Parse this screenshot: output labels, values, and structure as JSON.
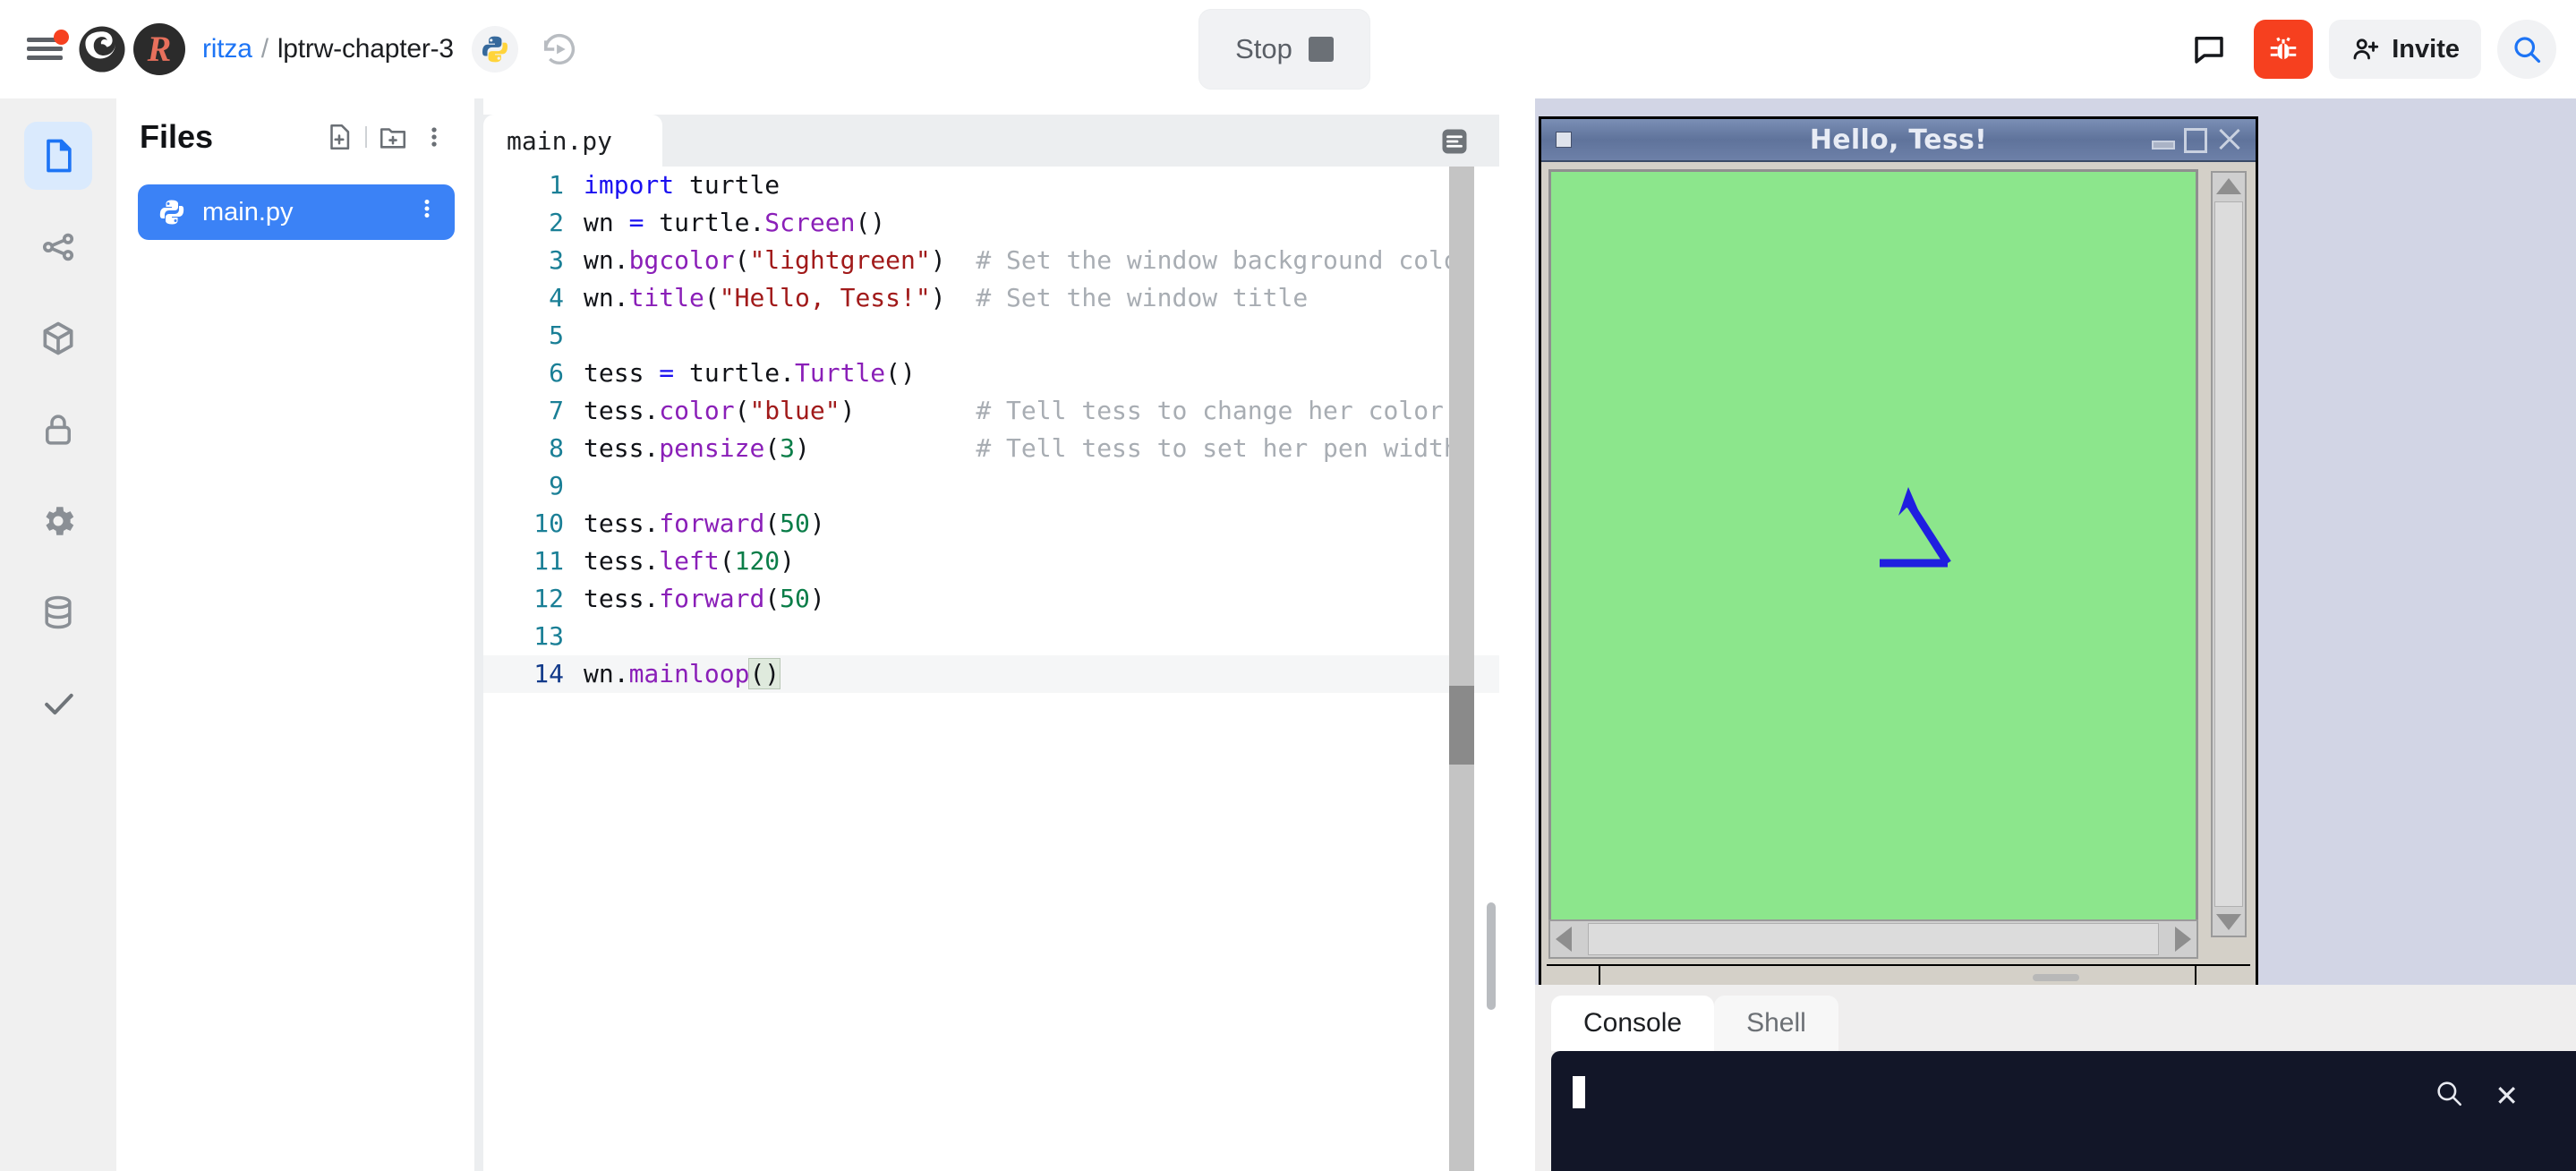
{
  "header": {
    "menu_icon": "hamburger-icon",
    "notification_dot": true,
    "logo_icon": "replit-logo-icon",
    "avatar_letter": "R",
    "breadcrumb": {
      "owner": "ritza",
      "separator": "/",
      "repo": "lptrw-chapter-3"
    },
    "language_badge_icon": "python-icon",
    "history_icon": "history-replay-icon",
    "run_button": {
      "label": "Stop",
      "icon": "stop-square-icon"
    },
    "chat_icon": "chat-bubble-icon",
    "bug_icon": "bug-icon",
    "bug_accent_color": "#f6401f",
    "invite_label": "Invite",
    "invite_icon": "person-add-icon",
    "search_icon": "search-icon"
  },
  "rail": {
    "items": [
      {
        "name": "files",
        "icon": "file-icon",
        "active": true
      },
      {
        "name": "version-control",
        "icon": "git-branch-icon",
        "active": false
      },
      {
        "name": "packages",
        "icon": "package-cube-icon",
        "active": false
      },
      {
        "name": "secrets",
        "icon": "lock-icon",
        "active": false
      },
      {
        "name": "settings",
        "icon": "gear-icon",
        "active": false
      },
      {
        "name": "database",
        "icon": "database-icon",
        "active": false
      },
      {
        "name": "checks",
        "icon": "check-icon",
        "active": false
      }
    ]
  },
  "files": {
    "title": "Files",
    "new_file_icon": "new-file-icon",
    "new_folder_icon": "new-folder-icon",
    "more_icon": "kebab-menu-icon",
    "entries": [
      {
        "name": "main.py",
        "icon": "python-icon",
        "selected": true,
        "more_icon": "kebab-menu-icon"
      }
    ]
  },
  "editor": {
    "tab_label": "main.py",
    "format_icon": "format-lines-icon",
    "active_line": 14,
    "lines": [
      {
        "n": "1",
        "tokens": [
          {
            "t": "kw",
            "s": "import"
          },
          {
            "t": "plain",
            "s": " turtle"
          }
        ],
        "comment": ""
      },
      {
        "n": "2",
        "tokens": [
          {
            "t": "plain",
            "s": "wn "
          },
          {
            "t": "op",
            "s": "="
          },
          {
            "t": "plain",
            "s": " turtle."
          },
          {
            "t": "cls",
            "s": "Screen"
          },
          {
            "t": "plain",
            "s": "()"
          }
        ],
        "comment": ""
      },
      {
        "n": "3",
        "tokens": [
          {
            "t": "plain",
            "s": "wn."
          },
          {
            "t": "fn",
            "s": "bgcolor"
          },
          {
            "t": "plain",
            "s": "("
          },
          {
            "t": "str",
            "s": "\"lightgreen\""
          },
          {
            "t": "plain",
            "s": ")"
          }
        ],
        "comment": "# Set the window background color"
      },
      {
        "n": "4",
        "tokens": [
          {
            "t": "plain",
            "s": "wn."
          },
          {
            "t": "fn",
            "s": "title"
          },
          {
            "t": "plain",
            "s": "("
          },
          {
            "t": "str",
            "s": "\"Hello, Tess!\""
          },
          {
            "t": "plain",
            "s": ")"
          }
        ],
        "comment": "# Set the window title"
      },
      {
        "n": "5",
        "tokens": [],
        "comment": ""
      },
      {
        "n": "6",
        "tokens": [
          {
            "t": "plain",
            "s": "tess "
          },
          {
            "t": "op",
            "s": "="
          },
          {
            "t": "plain",
            "s": " turtle."
          },
          {
            "t": "cls",
            "s": "Turtle"
          },
          {
            "t": "plain",
            "s": "()"
          }
        ],
        "comment": ""
      },
      {
        "n": "7",
        "tokens": [
          {
            "t": "plain",
            "s": "tess."
          },
          {
            "t": "fn",
            "s": "color"
          },
          {
            "t": "plain",
            "s": "("
          },
          {
            "t": "str",
            "s": "\"blue\""
          },
          {
            "t": "plain",
            "s": ")"
          }
        ],
        "comment": "# Tell tess to change her color"
      },
      {
        "n": "8",
        "tokens": [
          {
            "t": "plain",
            "s": "tess."
          },
          {
            "t": "fn",
            "s": "pensize"
          },
          {
            "t": "plain",
            "s": "("
          },
          {
            "t": "num",
            "s": "3"
          },
          {
            "t": "plain",
            "s": ")"
          }
        ],
        "comment": "# Tell tess to set her pen width"
      },
      {
        "n": "9",
        "tokens": [],
        "comment": ""
      },
      {
        "n": "10",
        "tokens": [
          {
            "t": "plain",
            "s": "tess."
          },
          {
            "t": "fn",
            "s": "forward"
          },
          {
            "t": "plain",
            "s": "("
          },
          {
            "t": "num",
            "s": "50"
          },
          {
            "t": "plain",
            "s": ")"
          }
        ],
        "comment": ""
      },
      {
        "n": "11",
        "tokens": [
          {
            "t": "plain",
            "s": "tess."
          },
          {
            "t": "fn",
            "s": "left"
          },
          {
            "t": "plain",
            "s": "("
          },
          {
            "t": "num",
            "s": "120"
          },
          {
            "t": "plain",
            "s": ")"
          }
        ],
        "comment": ""
      },
      {
        "n": "12",
        "tokens": [
          {
            "t": "plain",
            "s": "tess."
          },
          {
            "t": "fn",
            "s": "forward"
          },
          {
            "t": "plain",
            "s": "("
          },
          {
            "t": "num",
            "s": "50"
          },
          {
            "t": "plain",
            "s": ")"
          }
        ],
        "comment": ""
      },
      {
        "n": "13",
        "tokens": [],
        "comment": ""
      },
      {
        "n": "14",
        "tokens": [
          {
            "t": "plain",
            "s": "wn."
          },
          {
            "t": "fn",
            "s": "mainloop"
          },
          {
            "t": "hl",
            "s": "()"
          }
        ],
        "comment": ""
      }
    ]
  },
  "turtle_window": {
    "title": "Hello, Tess!",
    "system_menu_icon": "window-system-menu-icon",
    "minimize_icon": "window-minimize-icon",
    "maximize_icon": "window-maximize-icon",
    "close_icon": "window-close-icon",
    "canvas_color": "#8ce68c",
    "pen_color": "#1f1fe0",
    "scrollbar_vertical": "vertical-scrollbar",
    "scrollbar_horizontal": "horizontal-scrollbar"
  },
  "console": {
    "tabs": [
      {
        "label": "Console",
        "active": true
      },
      {
        "label": "Shell",
        "active": false
      }
    ],
    "search_icon": "search-icon",
    "close_icon": "close-icon",
    "close_glyph": "✕",
    "prompt_cursor": true,
    "output": ""
  }
}
